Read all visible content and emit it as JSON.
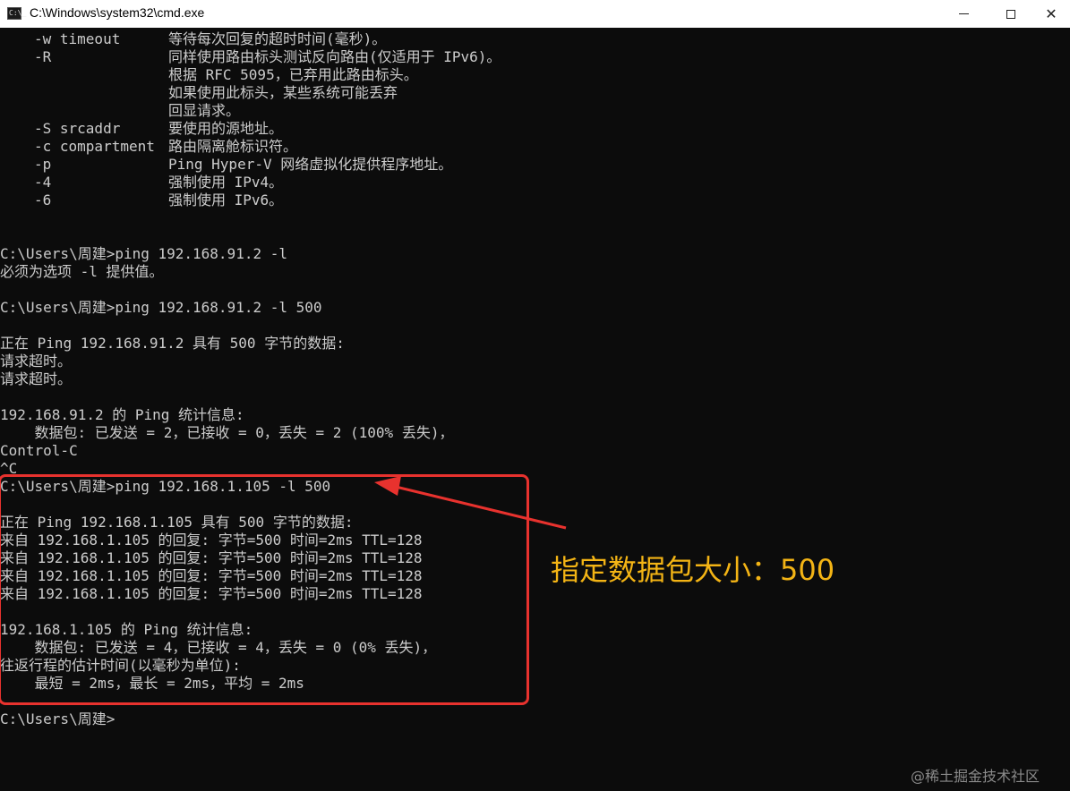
{
  "window": {
    "title": "C:\\Windows\\system32\\cmd.exe",
    "icon_label": "C:\\_",
    "minimize": "—",
    "maximize": "☐",
    "close": "✕"
  },
  "console": {
    "options": [
      {
        "flag": "-w timeout",
        "desc": "等待每次回复的超时时间(毫秒)。"
      },
      {
        "flag": "-R",
        "desc": "同样使用路由标头测试反向路由(仅适用于 IPv6)。"
      },
      {
        "flag": "",
        "desc": "根据 RFC 5095，已弃用此路由标头。"
      },
      {
        "flag": "",
        "desc": "如果使用此标头，某些系统可能丢弃"
      },
      {
        "flag": "",
        "desc": "回显请求。"
      },
      {
        "flag": "-S srcaddr",
        "desc": "要使用的源地址。"
      },
      {
        "flag": "-c compartment",
        "desc": "路由隔离舱标识符。"
      },
      {
        "flag": "-p",
        "desc": "Ping Hyper-V 网络虚拟化提供程序地址。"
      },
      {
        "flag": "-4",
        "desc": "强制使用 IPv4。"
      },
      {
        "flag": "-6",
        "desc": "强制使用 IPv6。"
      }
    ],
    "session": [
      "C:\\Users\\周建>ping 192.168.91.2 -l",
      "必须为选项 -l 提供值。",
      "C:\\Users\\周建>ping 192.168.91.2 -l 500",
      "正在 Ping 192.168.91.2 具有 500 字节的数据:",
      "请求超时。",
      "请求超时。",
      "192.168.91.2 的 Ping 统计信息:",
      "    数据包: 已发送 = 2，已接收 = 0，丢失 = 2 (100% 丢失)，",
      "Control-C",
      "^C",
      "C:\\Users\\周建>ping 192.168.1.105 -l 500",
      "正在 Ping 192.168.1.105 具有 500 字节的数据:",
      "来自 192.168.1.105 的回复: 字节=500 时间=2ms TTL=128",
      "来自 192.168.1.105 的回复: 字节=500 时间=2ms TTL=128",
      "来自 192.168.1.105 的回复: 字节=500 时间=2ms TTL=128",
      "来自 192.168.1.105 的回复: 字节=500 时间=2ms TTL=128",
      "192.168.1.105 的 Ping 统计信息:",
      "    数据包: 已发送 = 4，已接收 = 4，丢失 = 0 (0% 丢失)，",
      "往返行程的估计时间(以毫秒为单位):",
      "    最短 = 2ms，最长 = 2ms，平均 = 2ms",
      "C:\\Users\\周建>"
    ]
  },
  "annotation": {
    "text": "指定数据包大小：500",
    "color": "#f3b415",
    "highlight_color": "#e8322e"
  },
  "watermark": "@稀土掘金技术社区"
}
